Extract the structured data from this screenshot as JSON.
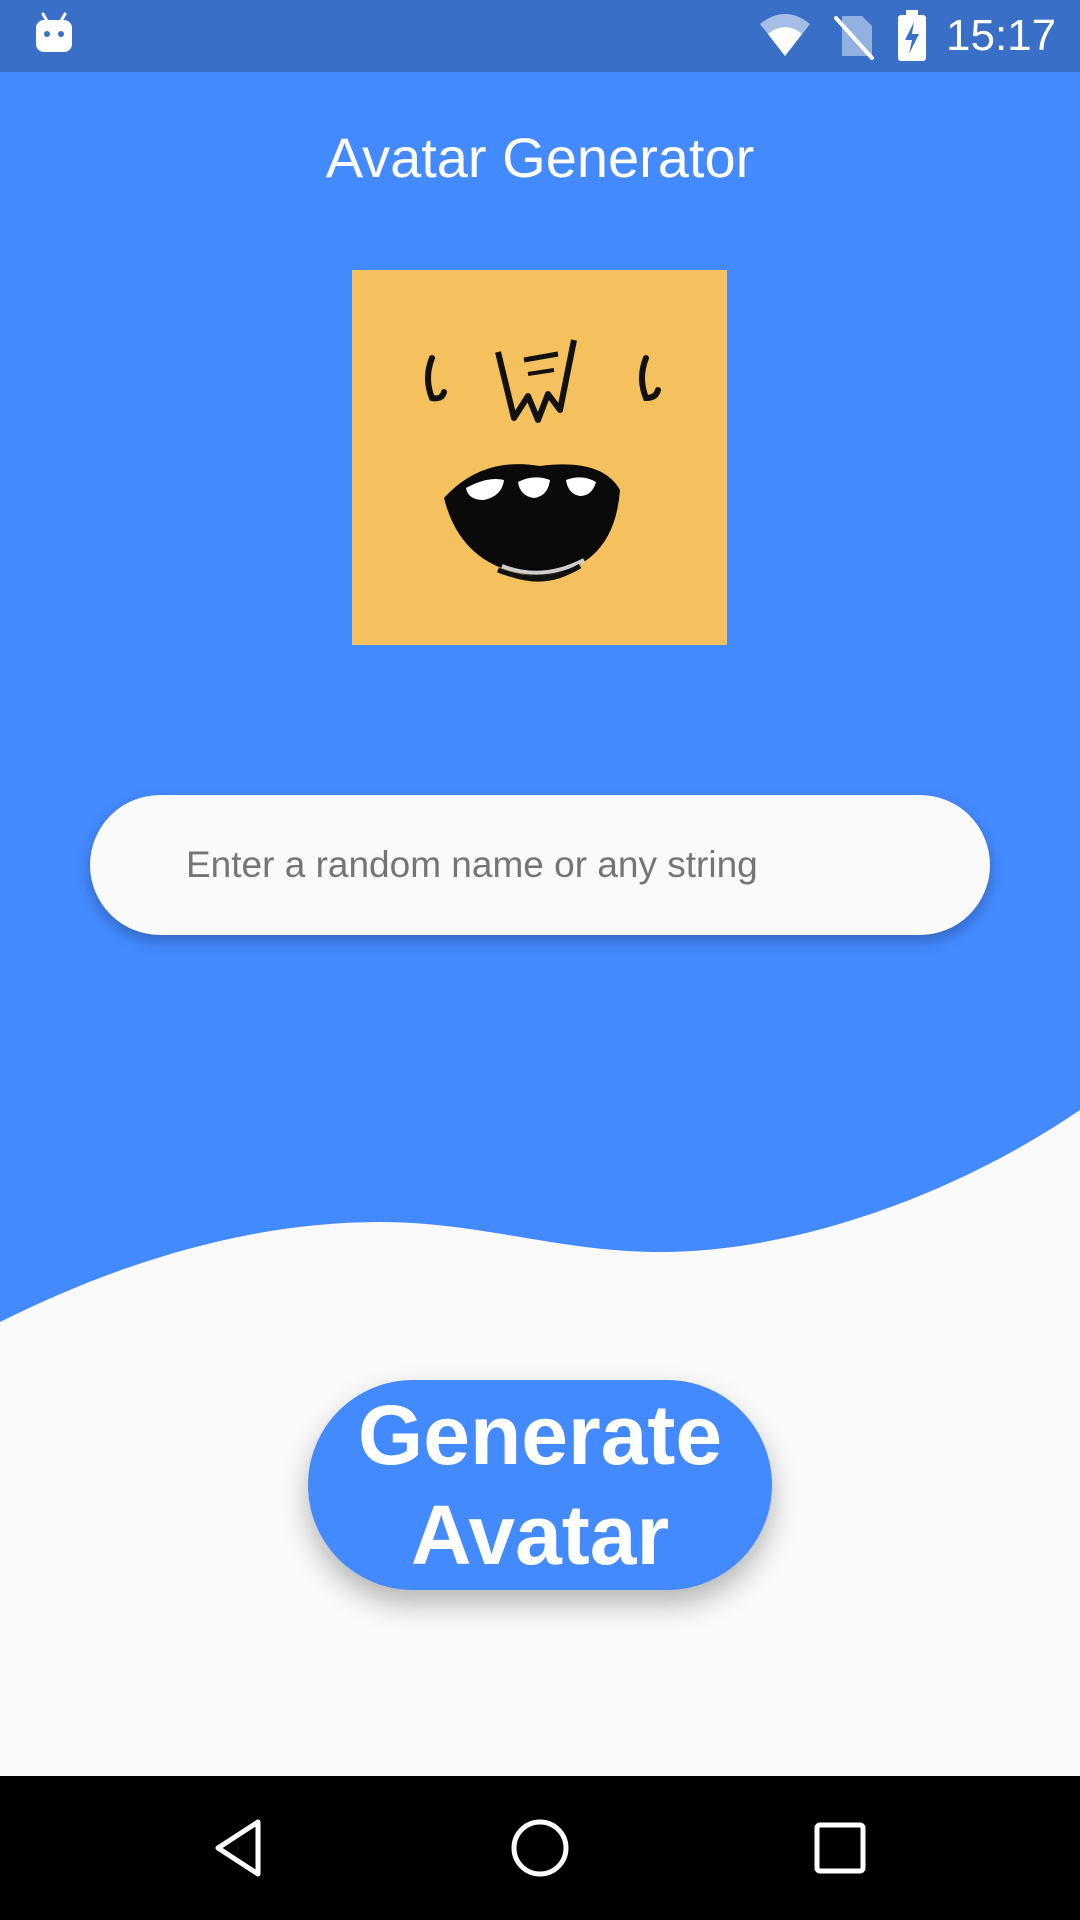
{
  "status_bar": {
    "time": "15:17",
    "icons": [
      "android-notification-icon",
      "wifi-icon",
      "no-sim-icon",
      "battery-charging-icon"
    ]
  },
  "app": {
    "title": "Avatar Generator"
  },
  "avatar": {
    "icon": "avatar-face-icon",
    "background_color": "#f5c05e"
  },
  "search": {
    "placeholder": "Enter a random name or any string",
    "value": ""
  },
  "generate_button": {
    "label": "Generate Avatar"
  },
  "nav_bar": {
    "icons": [
      "back-icon",
      "home-icon",
      "recents-icon"
    ]
  },
  "colors": {
    "accent": "#448aff",
    "status_bar": "#3a6fc7",
    "background": "#fafafa"
  }
}
